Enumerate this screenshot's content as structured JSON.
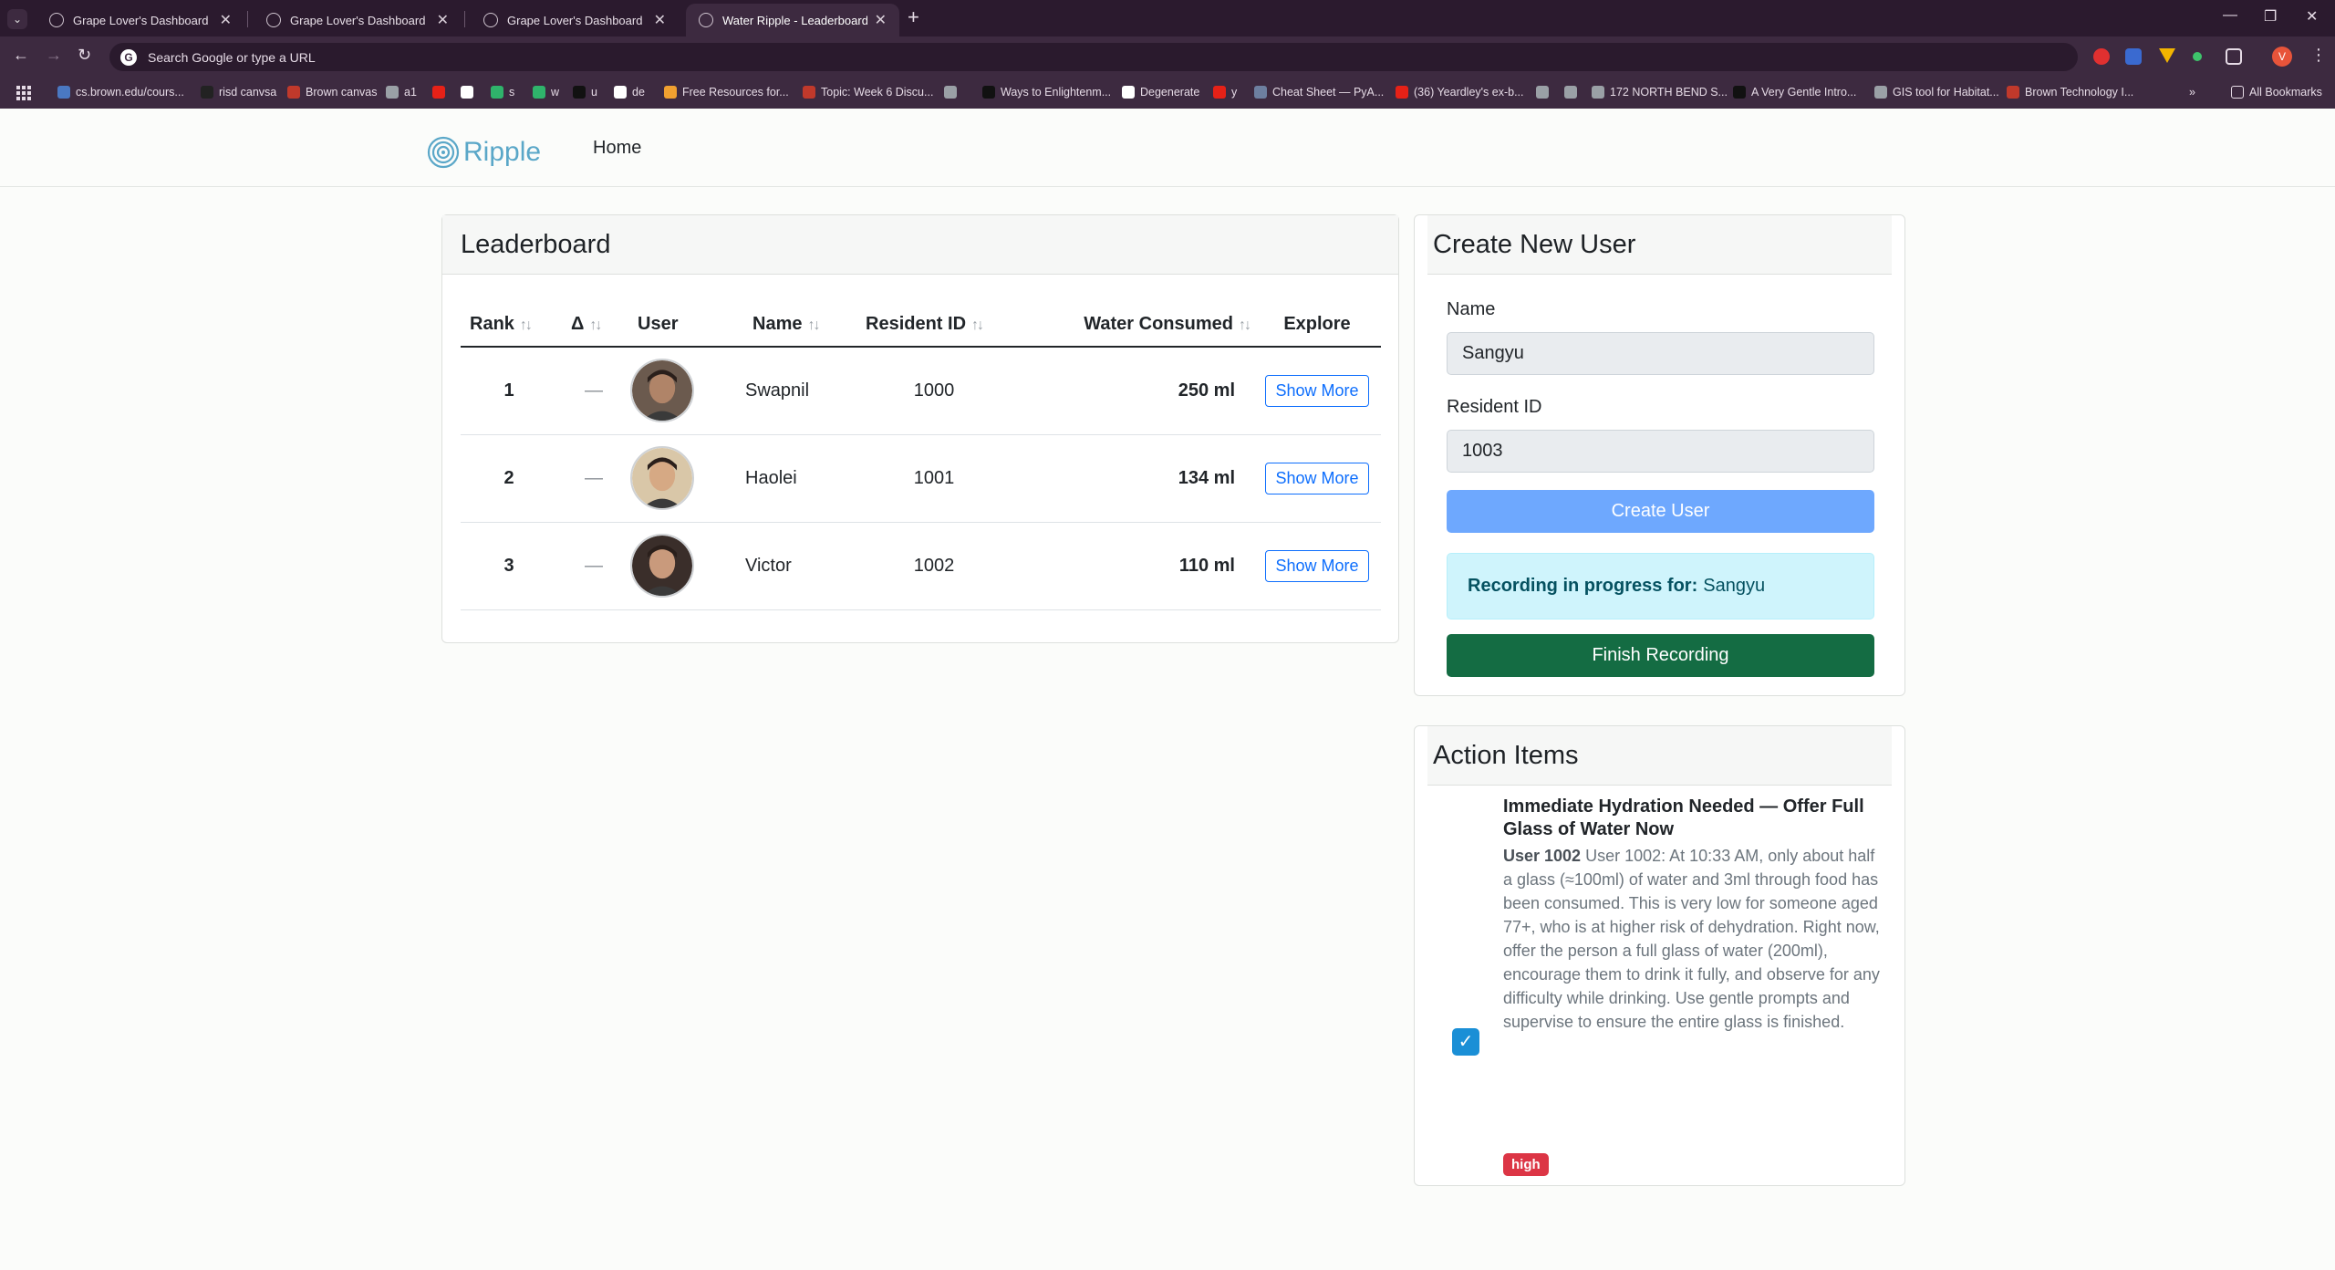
{
  "browser": {
    "tabs": [
      {
        "title": "Grape Lover's Dashboard",
        "active": false
      },
      {
        "title": "Grape Lover's Dashboard",
        "active": false
      },
      {
        "title": "Grape Lover's Dashboard",
        "active": false
      },
      {
        "title": "Water Ripple - Leaderboard",
        "active": true
      }
    ],
    "address_placeholder": "Search Google or type a URL",
    "profile_initial": "V",
    "bookmarks": [
      {
        "label": "cs.brown.edu/cours...",
        "color": "#4a78c2"
      },
      {
        "label": "risd canvsa",
        "color": "#222222"
      },
      {
        "label": "Brown canvas",
        "color": "#c0392b"
      },
      {
        "label": "a1",
        "color": "#9aa0a6"
      },
      {
        "label": "",
        "color": "#e62117"
      },
      {
        "label": "",
        "color": "#ffffff"
      },
      {
        "label": "s",
        "color": "#2fb36b"
      },
      {
        "label": "w",
        "color": "#2fb36b"
      },
      {
        "label": "u",
        "color": "#111111"
      },
      {
        "label": "de",
        "color": "#ffffff"
      },
      {
        "label": "Free Resources for...",
        "color": "#f0a030"
      },
      {
        "label": "Topic: Week 6 Discu...",
        "color": "#c0392b"
      },
      {
        "label": "",
        "color": "#9aa0a6"
      },
      {
        "label": "Ways to Enlightenm...",
        "color": "#111111"
      },
      {
        "label": "Degenerate",
        "color": "#ffffff"
      },
      {
        "label": "y",
        "color": "#e62117"
      },
      {
        "label": "Cheat Sheet — PyA...",
        "color": "#6d7fa0"
      },
      {
        "label": "(36) Yeardley's ex-b...",
        "color": "#e62117"
      },
      {
        "label": "",
        "color": "#9aa0a6"
      },
      {
        "label": "",
        "color": "#9aa0a6"
      },
      {
        "label": "172 NORTH BEND S...",
        "color": "#9aa0a6"
      },
      {
        "label": "A Very Gentle Intro...",
        "color": "#111111"
      },
      {
        "label": "GIS tool for Habitat...",
        "color": "#9aa0a6"
      },
      {
        "label": "Brown Technology I...",
        "color": "#c0392b"
      }
    ],
    "all_bookmarks": "All Bookmarks"
  },
  "nav": {
    "brand": "Ripple",
    "home": "Home"
  },
  "leaderboard": {
    "title": "Leaderboard",
    "columns": {
      "rank": "Rank",
      "delta": "Δ",
      "user": "User",
      "name": "Name",
      "resident_id": "Resident ID",
      "water": "Water Consumed",
      "explore": "Explore"
    },
    "rows": [
      {
        "rank": "1",
        "delta": "—",
        "name": "Swapnil",
        "resident_id": "1000",
        "water": "250 ml",
        "button": "Show More",
        "avatar_bg": "#6b5a4e",
        "avatar_face": "#b08468"
      },
      {
        "rank": "2",
        "delta": "—",
        "name": "Haolei",
        "resident_id": "1001",
        "water": "134 ml",
        "button": "Show More",
        "avatar_bg": "#d9c7a8",
        "avatar_face": "#d6a984"
      },
      {
        "rank": "3",
        "delta": "—",
        "name": "Victor",
        "resident_id": "1002",
        "water": "110 ml",
        "button": "Show More",
        "avatar_bg": "#3a2e2a",
        "avatar_face": "#c99a7c"
      }
    ]
  },
  "create_user": {
    "title": "Create New User",
    "name_label": "Name",
    "name_value": "Sangyu",
    "resident_label": "Resident ID",
    "resident_value": "1003",
    "create_button": "Create User",
    "recording_label": "Recording in progress for:",
    "recording_name": "Sangyu",
    "finish_button": "Finish Recording"
  },
  "action_items": {
    "title": "Action Items",
    "items": [
      {
        "title": "Immediate Hydration Needed — Offer Full Glass of Water Now",
        "user": "User 1002",
        "body": "User 1002: At 10:33 AM, only about half a glass (≈100ml) of water and 3ml through food has been consumed. This is very low for someone aged 77+, who is at higher risk of dehydration. Right now, offer the person a full glass of water (200ml), encourage them to drink it fully, and observe for any difficulty while drinking. Use gentle prompts and supervise to ensure the entire glass is finished.",
        "priority": "high"
      }
    ]
  },
  "colors": {
    "brand": "#5aa7c8",
    "primary": "#0d6efd",
    "success": "#146c43",
    "danger": "#dc3545"
  }
}
